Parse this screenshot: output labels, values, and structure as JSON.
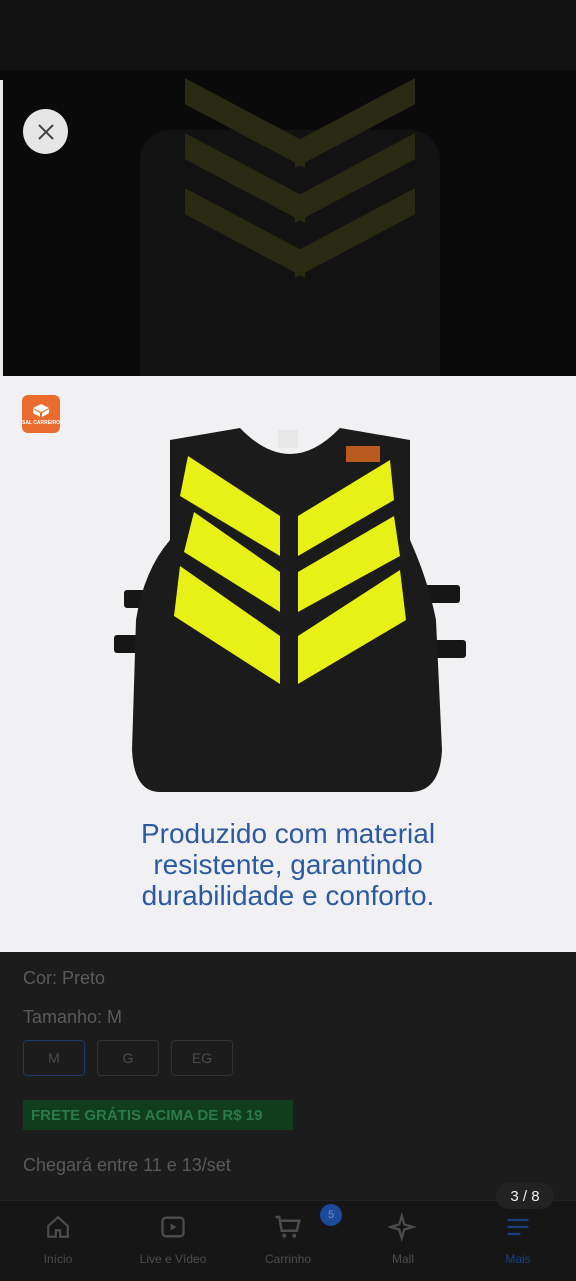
{
  "viewer": {
    "caption_lines": [
      "Produzido com material",
      "resistente, garantindo",
      "durabilidade e conforto."
    ],
    "page_counter": "3 / 8",
    "brand_logo_text": "SAL CARREIRO",
    "close_icon": "close-icon"
  },
  "product_options": {
    "color_label": "Cor: Preto",
    "size_label": "Tamanho: M",
    "sizes": [
      "M",
      "G",
      "EG"
    ],
    "selected_size": "M",
    "shipping_badge": "FRETE GRÁTIS ACIMA DE R$ 19",
    "delivery_text": "Chegará entre 11 e 13/set"
  },
  "bottom_nav": {
    "items": [
      {
        "label": "Início",
        "icon": "home-icon"
      },
      {
        "label": "Live e Vídeo",
        "icon": "play-icon"
      },
      {
        "label": "Carrinho",
        "icon": "cart-icon",
        "badge": "5"
      },
      {
        "label": "Mall",
        "icon": "sparkle-icon"
      },
      {
        "label": "Mais",
        "icon": "menu-icon"
      }
    ]
  },
  "colors": {
    "caption": "#2c5aa0",
    "vest_body": "#1b1b1b",
    "vest_stripe": "#e8f116",
    "logo": "#e96b2e"
  }
}
